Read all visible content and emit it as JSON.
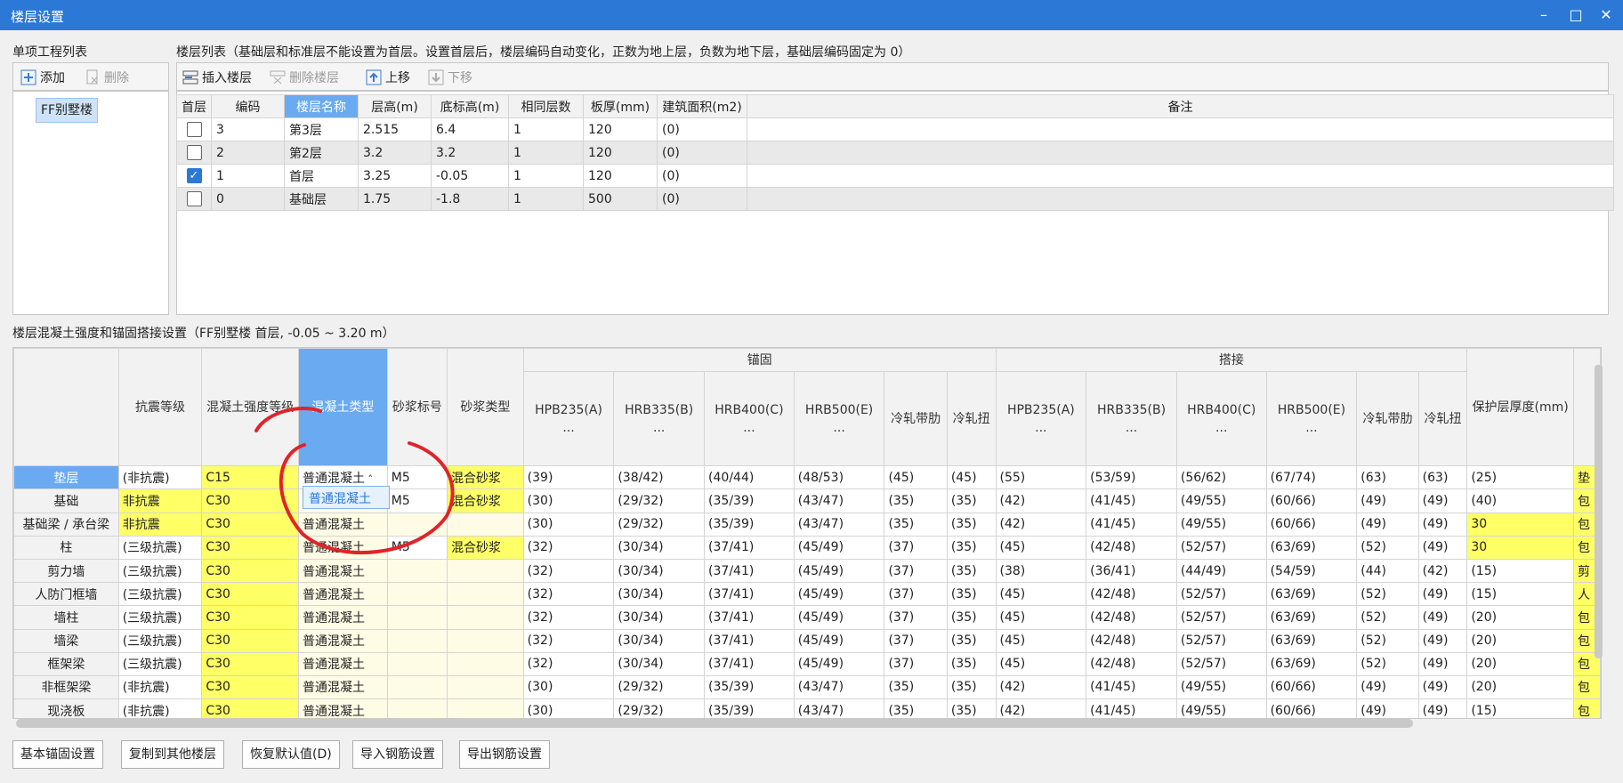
{
  "window": {
    "title": "楼层设置"
  },
  "left_panel": {
    "title": "单项工程列表",
    "add_label": "添加",
    "delete_label": "删除",
    "items": [
      "FF别墅楼"
    ]
  },
  "floor_panel": {
    "title": "楼层列表（基础层和标准层不能设置为首层。设置首层后，楼层编码自动变化，正数为地上层，负数为地下层，基础层编码固定为 0）",
    "toolbar": {
      "insert": "插入楼层",
      "delete": "删除楼层",
      "up": "上移",
      "down": "下移"
    },
    "headers": [
      "首层",
      "编码",
      "楼层名称",
      "层高(m)",
      "底标高(m)",
      "相同层数",
      "板厚(mm)",
      "建筑面积(m2)",
      "备注"
    ],
    "rows": [
      {
        "first": false,
        "code": "3",
        "name": "第3层",
        "height": "2.515",
        "bottom": "6.4",
        "count": "1",
        "thick": "120",
        "area": "(0)",
        "note": ""
      },
      {
        "first": false,
        "code": "2",
        "name": "第2层",
        "height": "3.2",
        "bottom": "3.2",
        "count": "1",
        "thick": "120",
        "area": "(0)",
        "note": ""
      },
      {
        "first": true,
        "code": "1",
        "name": "首层",
        "height": "3.25",
        "bottom": "-0.05",
        "count": "1",
        "thick": "120",
        "area": "(0)",
        "note": ""
      },
      {
        "first": false,
        "code": "0",
        "name": "基础层",
        "height": "1.75",
        "bottom": "-1.8",
        "count": "1",
        "thick": "500",
        "area": "(0)",
        "note": ""
      }
    ]
  },
  "concrete_panel": {
    "title": "楼层混凝土强度和锚固搭接设置（FF别墅楼 首层, -0.05 ~ 3.20 m）",
    "group_anchor": "锚固",
    "group_lap": "搭接",
    "headers": [
      "抗震等级",
      "混凝土强度等级",
      "混凝土类型",
      "砂浆标号",
      "砂浆类型",
      "HPB235(A) ...",
      "HRB335(B) ...",
      "HRB400(C) ...",
      "HRB500(E) ...",
      "冷轧带肋",
      "冷轧扭",
      "HPB235(A) ...",
      "HRB335(B) ...",
      "HRB400(C) ...",
      "HRB500(E) ...",
      "冷轧带肋",
      "冷轧扭",
      "保护层厚度(mm)"
    ],
    "rows": [
      {
        "name": "垫层",
        "cells": [
          "(非抗震)",
          "C15",
          "普通混凝土",
          "M5",
          "混合砂浆",
          "(39)",
          "(38/42)",
          "(40/44)",
          "(48/53)",
          "(45)",
          "(45)",
          "(55)",
          "(53/59)",
          "(56/62)",
          "(67/74)",
          "(63)",
          "(63)",
          "(25)",
          "垫"
        ]
      },
      {
        "name": "基础",
        "cells": [
          "非抗震",
          "C30",
          "普通混凝土",
          "M5",
          "混合砂浆",
          "(30)",
          "(29/32)",
          "(35/39)",
          "(43/47)",
          "(35)",
          "(35)",
          "(42)",
          "(41/45)",
          "(49/55)",
          "(60/66)",
          "(49)",
          "(49)",
          "(40)",
          "包"
        ]
      },
      {
        "name": "基础梁 / 承台梁",
        "cells": [
          "非抗震",
          "C30",
          "普通混凝土",
          "",
          "",
          "(30)",
          "(29/32)",
          "(35/39)",
          "(43/47)",
          "(35)",
          "(35)",
          "(42)",
          "(41/45)",
          "(49/55)",
          "(60/66)",
          "(49)",
          "(49)",
          "30",
          "包"
        ]
      },
      {
        "name": "柱",
        "cells": [
          "(三级抗震)",
          "C30",
          "普通混凝土",
          "M5",
          "混合砂浆",
          "(32)",
          "(30/34)",
          "(37/41)",
          "(45/49)",
          "(37)",
          "(35)",
          "(45)",
          "(42/48)",
          "(52/57)",
          "(63/69)",
          "(52)",
          "(49)",
          "30",
          "包"
        ]
      },
      {
        "name": "剪力墙",
        "cells": [
          "(三级抗震)",
          "C30",
          "普通混凝土",
          "",
          "",
          "(32)",
          "(30/34)",
          "(37/41)",
          "(45/49)",
          "(37)",
          "(35)",
          "(38)",
          "(36/41)",
          "(44/49)",
          "(54/59)",
          "(44)",
          "(42)",
          "(15)",
          "剪"
        ]
      },
      {
        "name": "人防门框墙",
        "cells": [
          "(三级抗震)",
          "C30",
          "普通混凝土",
          "",
          "",
          "(32)",
          "(30/34)",
          "(37/41)",
          "(45/49)",
          "(37)",
          "(35)",
          "(45)",
          "(42/48)",
          "(52/57)",
          "(63/69)",
          "(52)",
          "(49)",
          "(15)",
          "人"
        ]
      },
      {
        "name": "墙柱",
        "cells": [
          "(三级抗震)",
          "C30",
          "普通混凝土",
          "",
          "",
          "(32)",
          "(30/34)",
          "(37/41)",
          "(45/49)",
          "(37)",
          "(35)",
          "(45)",
          "(42/48)",
          "(52/57)",
          "(63/69)",
          "(52)",
          "(49)",
          "(20)",
          "包"
        ]
      },
      {
        "name": "墙梁",
        "cells": [
          "(三级抗震)",
          "C30",
          "普通混凝土",
          "",
          "",
          "(32)",
          "(30/34)",
          "(37/41)",
          "(45/49)",
          "(37)",
          "(35)",
          "(45)",
          "(42/48)",
          "(52/57)",
          "(63/69)",
          "(52)",
          "(49)",
          "(20)",
          "包"
        ]
      },
      {
        "name": "框架梁",
        "cells": [
          "(三级抗震)",
          "C30",
          "普通混凝土",
          "",
          "",
          "(32)",
          "(30/34)",
          "(37/41)",
          "(45/49)",
          "(37)",
          "(35)",
          "(45)",
          "(42/48)",
          "(52/57)",
          "(63/69)",
          "(52)",
          "(49)",
          "(20)",
          "包"
        ]
      },
      {
        "name": "非框架梁",
        "cells": [
          "(非抗震)",
          "C30",
          "普通混凝土",
          "",
          "",
          "(30)",
          "(29/32)",
          "(35/39)",
          "(43/47)",
          "(35)",
          "(35)",
          "(42)",
          "(41/45)",
          "(49/55)",
          "(60/66)",
          "(49)",
          "(49)",
          "(20)",
          "包"
        ]
      },
      {
        "name": "现浇板",
        "cells": [
          "(非抗震)",
          "C30",
          "普通混凝土",
          "",
          "",
          "(30)",
          "(29/32)",
          "(35/39)",
          "(43/47)",
          "(35)",
          "(35)",
          "(42)",
          "(41/45)",
          "(49/55)",
          "(60/66)",
          "(49)",
          "(49)",
          "(15)",
          "包"
        ]
      }
    ],
    "dropdown_option": "普通混凝土"
  },
  "bottom_buttons": [
    "基本锚固设置",
    "复制到其他楼层",
    "恢复默认值(D)",
    "导入钢筋设置",
    "导出钢筋设置"
  ],
  "colors": {
    "title_bar": "#2b78d6",
    "highlight_yellow": "#ffff66",
    "light_yellow": "#fffce6",
    "selected_blue": "#6aaaf1",
    "annotation_red": "#e0242a"
  }
}
